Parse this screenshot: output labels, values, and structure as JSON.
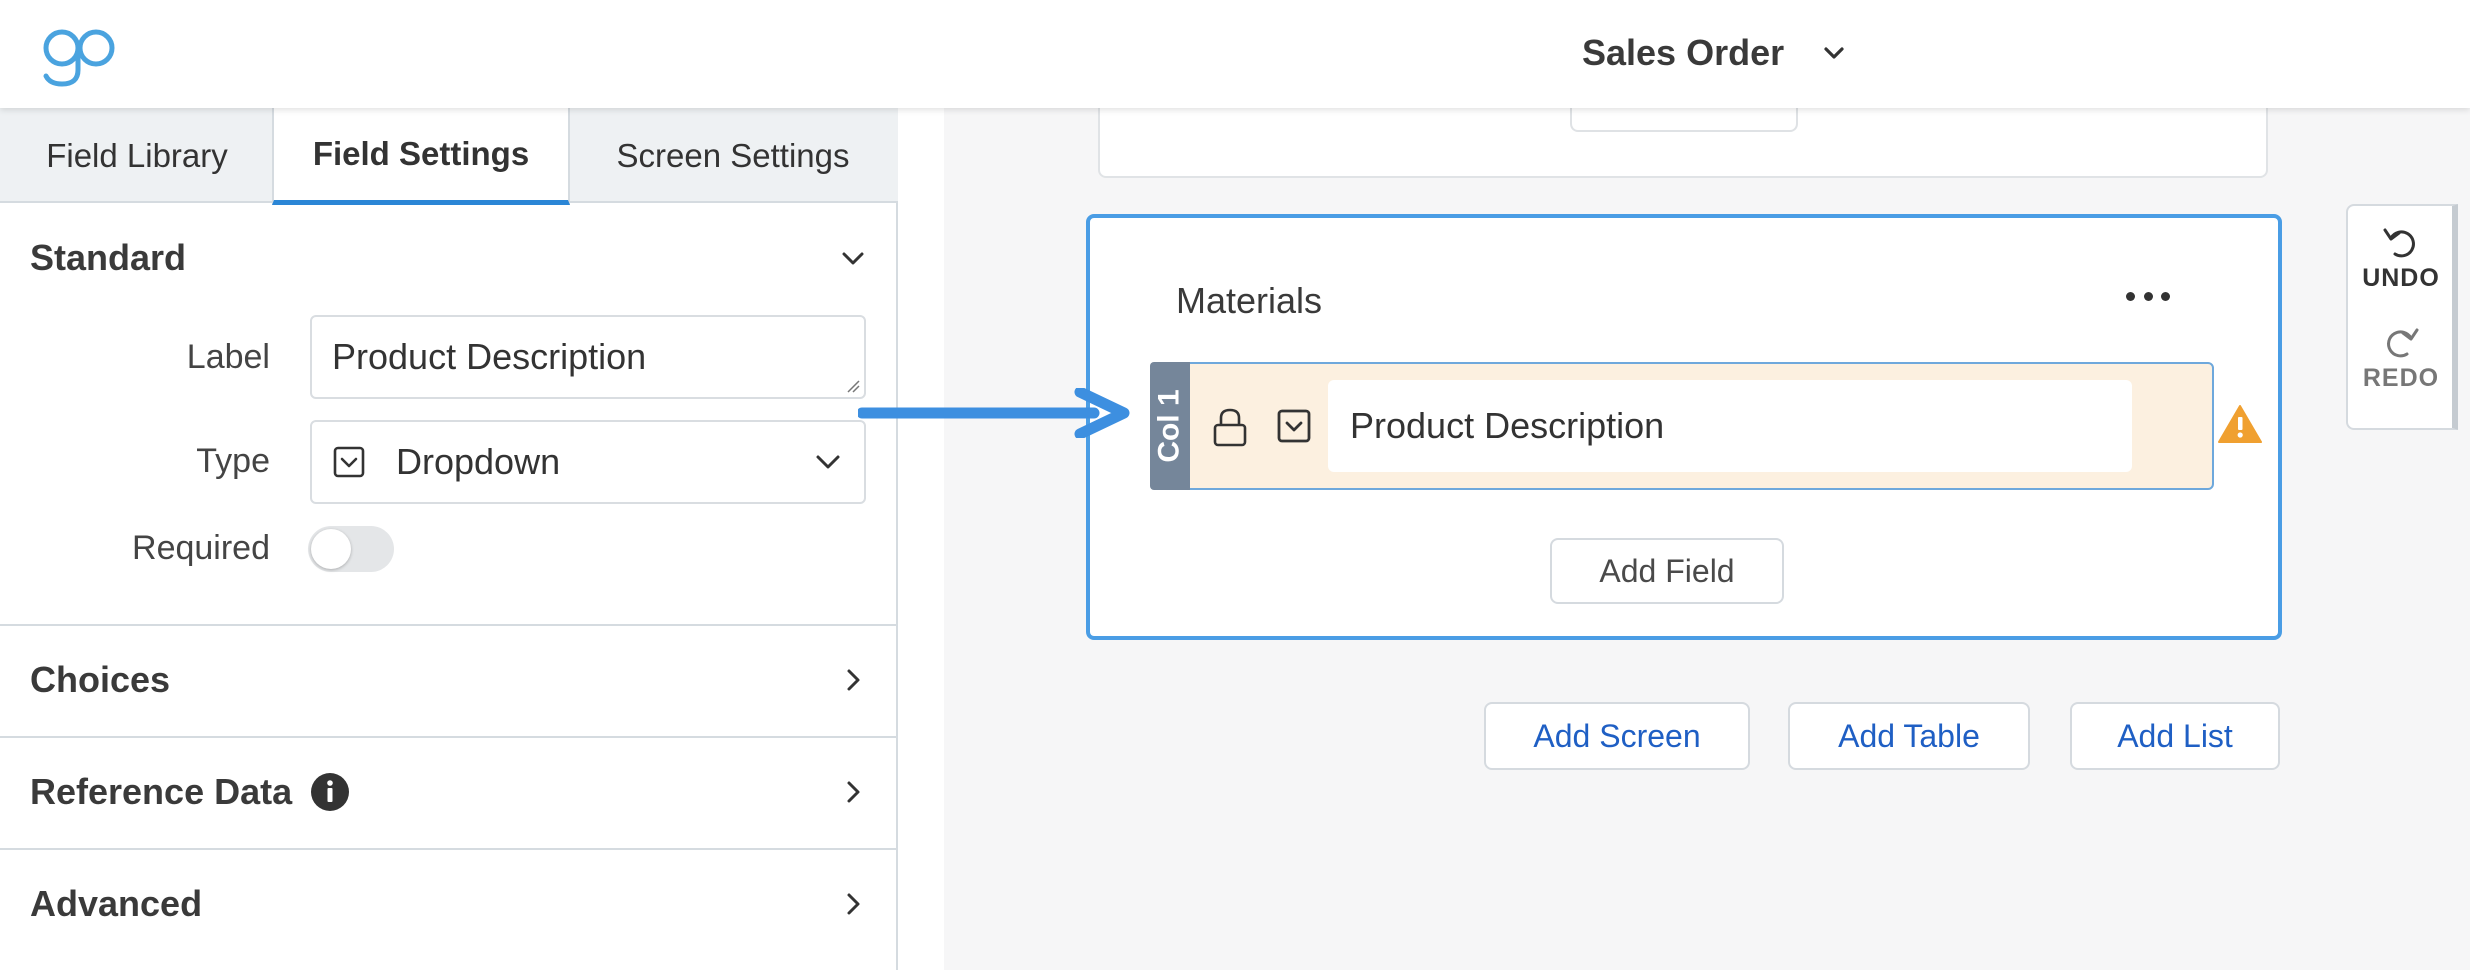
{
  "header": {
    "logo_icon": "go-logo-icon",
    "form_title": "Sales Order"
  },
  "left_panel": {
    "tabs": [
      {
        "label": "Field Library",
        "active": false
      },
      {
        "label": "Field Settings",
        "active": true
      },
      {
        "label": "Screen Settings",
        "active": false
      }
    ],
    "standard": {
      "title": "Standard",
      "label_label": "Label",
      "label_value": "Product Description",
      "type_label": "Type",
      "type_value": "Dropdown",
      "required_label": "Required",
      "required_on": false
    },
    "sections": [
      {
        "title": "Choices"
      },
      {
        "title": "Reference Data",
        "info_icon": "info-icon"
      },
      {
        "title": "Advanced"
      }
    ]
  },
  "canvas": {
    "table": {
      "title": "Materials",
      "column_tag": "Col 1",
      "field_label": "Product Description",
      "add_field": "Add Field"
    },
    "actions": {
      "add_screen": "Add Screen",
      "add_table": "Add Table",
      "add_list": "Add List"
    },
    "history": {
      "undo": "UNDO",
      "redo": "REDO"
    }
  },
  "colors": {
    "accent": "#2b86d6",
    "link": "#1f5fc4",
    "warning": "#f0a030",
    "row_highlight": "#fcf0e0"
  }
}
